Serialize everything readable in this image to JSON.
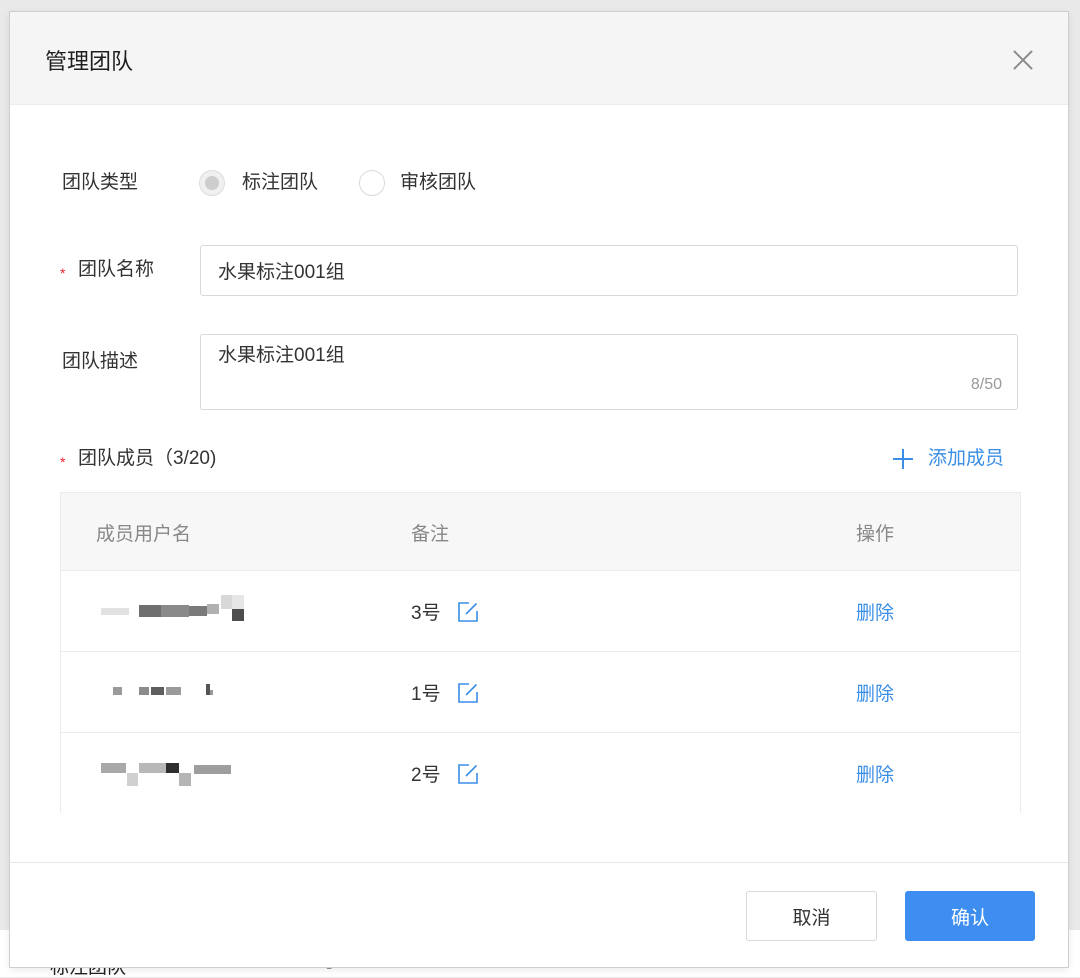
{
  "dialog": {
    "title": "管理团队",
    "close_icon": "close-icon"
  },
  "form": {
    "team_type": {
      "label": "团队类型",
      "options": [
        {
          "label": "标注团队",
          "checked": true,
          "disabled": true
        },
        {
          "label": "审核团队",
          "checked": false
        }
      ]
    },
    "team_name": {
      "required_mark": "*",
      "label": "团队名称",
      "value": "水果标注001组"
    },
    "team_desc": {
      "label": "团队描述",
      "value": "水果标注001组",
      "counter": "8/50"
    },
    "members": {
      "required_mark": "*",
      "label": "团队成员（3/20)",
      "add_icon": "plus-icon",
      "add_label": "添加成员"
    }
  },
  "table": {
    "columns": [
      "成员用户名",
      "备注",
      "操作"
    ],
    "rows": [
      {
        "username_redacted": true,
        "note": "3号",
        "note_icon": "edit-icon",
        "action": "删除"
      },
      {
        "username_redacted": true,
        "note": "1号",
        "note_icon": "edit-icon",
        "action": "删除"
      },
      {
        "username_redacted": true,
        "note": "2号",
        "note_icon": "edit-icon",
        "action": "删除"
      }
    ]
  },
  "footer": {
    "cancel_label": "取消",
    "confirm_label": "确认"
  },
  "background": {
    "fragment_left": "标注团队",
    "fragment_right": "-"
  },
  "colors": {
    "accent": "#3a8ee6",
    "required": "#f5222d",
    "primary_button": "#3d8ef0"
  }
}
